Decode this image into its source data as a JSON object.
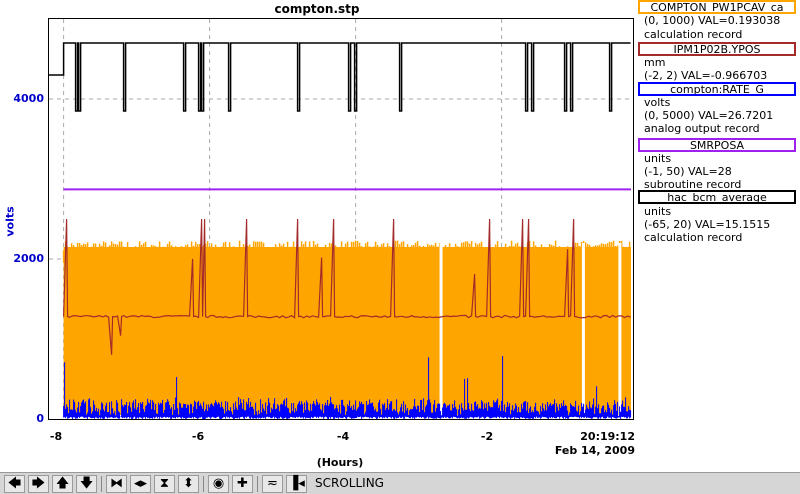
{
  "plot": {
    "title": "compton.stp",
    "y_axis_label": "volts",
    "x_axis_label": "(Hours)",
    "y_ticks": [
      "4000",
      "2000",
      "0"
    ],
    "x_ticks": [
      "-8",
      "-6",
      "-4",
      "-2"
    ],
    "time_readout": "20:19:12",
    "date_readout": "Feb 14, 2009"
  },
  "legend": [
    {
      "name": "COMPTON_PW1PCAV_ca",
      "range_value": "(0, 1000) VAL=0.193038",
      "record": "calculation record",
      "units": "",
      "color": "#ffa500"
    },
    {
      "name": "IPM1P02B.YPOS",
      "units": "mm",
      "range_value": "(-2, 2) VAL=-0.966703",
      "record": "",
      "color": "#a52a2a"
    },
    {
      "name": "compton:RATE_G",
      "units": "volts",
      "range_value": "(0, 5000) VAL=26.7201",
      "record": "analog output record",
      "color": "#0000ff"
    },
    {
      "name": "SMRPOSA",
      "units": "units",
      "range_value": "(-1, 50) VAL=28",
      "record": "subroutine record",
      "color": "#a020f0"
    },
    {
      "name": "hac_bcm_average",
      "units": "units",
      "range_value": "(-65, 20) VAL=15.1515",
      "record": "calculation record",
      "color": "#000000"
    }
  ],
  "toolbar": {
    "status": "SCROLLING",
    "buttons": [
      {
        "name": "pan-left-button",
        "glyph": "🡄"
      },
      {
        "name": "pan-right-button",
        "glyph": "🡆"
      },
      {
        "name": "pan-up-button",
        "glyph": "🡅"
      },
      {
        "name": "pan-down-button",
        "glyph": "🡇"
      },
      {
        "name": "zoom-in-x-button",
        "glyph": "⧓"
      },
      {
        "name": "zoom-out-x-button",
        "glyph": "◂▸"
      },
      {
        "name": "zoom-in-y-button",
        "glyph": "⧗"
      },
      {
        "name": "zoom-out-y-button",
        "glyph": "⬍"
      },
      {
        "name": "reset-button",
        "glyph": "◉"
      },
      {
        "name": "add-button",
        "glyph": "✚"
      },
      {
        "name": "autoscale-button",
        "glyph": "≂"
      },
      {
        "name": "scroll-toggle-button",
        "glyph": "▐◂"
      }
    ]
  },
  "chart_data": {
    "type": "line",
    "title": "compton.stp",
    "xlabel": "(Hours)",
    "ylabel": "volts",
    "xlim": [
      -8.2,
      -0.2
    ],
    "ylim": [
      0,
      5000
    ],
    "grid": true,
    "series": [
      {
        "name": "hac_bcm_average",
        "color": "#000000",
        "level_high": 4700,
        "level_low": 3850
      },
      {
        "name": "SMRPOSA",
        "color": "#a020f0",
        "value": 2870
      },
      {
        "name": "IPM1P02B.YPOS",
        "color": "#a52a2a",
        "baseline": 1280,
        "spike_max": 2500
      },
      {
        "name": "COMPTON_PW1PCAV_ca",
        "color": "#ffa500",
        "band_low": 50,
        "band_high": 2150
      },
      {
        "name": "compton:RATE_G",
        "color": "#0000ff",
        "band_low": 30,
        "band_high": 200
      }
    ]
  }
}
